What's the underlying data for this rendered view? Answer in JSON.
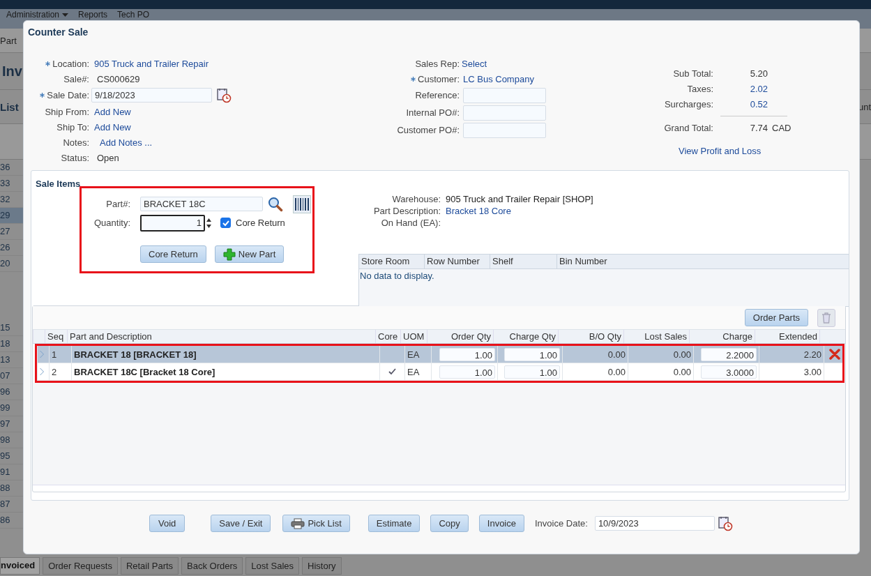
{
  "app_bar": {
    "menu": [
      {
        "label": "Administration",
        "has_dropdown": true
      },
      {
        "label": "Reports",
        "has_dropdown": false
      },
      {
        "label": "Tech PO",
        "has_dropdown": false
      }
    ]
  },
  "background": {
    "breadcrumb": "Part",
    "heading": "Inv",
    "section_title": "List",
    "right_header": "unt",
    "rows_upper": [
      {
        "value": "36",
        "selected": false
      },
      {
        "value": "33",
        "selected": false
      },
      {
        "value": "32",
        "selected": false
      },
      {
        "value": "29",
        "selected": true
      },
      {
        "value": "27",
        "selected": false
      },
      {
        "value": "26",
        "selected": false
      },
      {
        "value": "20",
        "selected": false
      }
    ],
    "rows_lower": [
      {
        "value": "15",
        "selected": false
      },
      {
        "value": "18",
        "selected": false
      },
      {
        "value": "13",
        "selected": false
      },
      {
        "value": "07",
        "selected": false
      },
      {
        "value": "96",
        "selected": false
      },
      {
        "value": "99",
        "selected": false
      },
      {
        "value": "97",
        "selected": false
      },
      {
        "value": "98",
        "selected": false
      },
      {
        "value": "95",
        "selected": false
      },
      {
        "value": "91",
        "selected": false
      },
      {
        "value": "88",
        "selected": false
      },
      {
        "value": "87",
        "selected": false
      },
      {
        "value": "86",
        "selected": false
      }
    ]
  },
  "bottom_tabs": [
    {
      "label": "nvoiced",
      "selected": true
    },
    {
      "label": "Order Requests",
      "selected": false
    },
    {
      "label": "Retail Parts",
      "selected": false
    },
    {
      "label": "Back Orders",
      "selected": false
    },
    {
      "label": "Lost Sales",
      "selected": false
    },
    {
      "label": "History",
      "selected": false
    }
  ],
  "dialog": {
    "title": "Counter Sale",
    "left_fields": [
      {
        "label": "Location:",
        "required": true,
        "kind": "link",
        "value": "905 Truck and Trailer Repair"
      },
      {
        "label": "Sale#:",
        "required": false,
        "kind": "text",
        "value": "CS000629"
      },
      {
        "label": "Sale Date:",
        "required": true,
        "kind": "date",
        "value": "9/18/2023"
      },
      {
        "label": "Ship From:",
        "required": false,
        "kind": "link",
        "value": "Add New"
      },
      {
        "label": "Ship To:",
        "required": false,
        "kind": "link",
        "value": "Add New"
      },
      {
        "label": "Notes:",
        "required": false,
        "kind": "link",
        "value": "Add Notes ..."
      },
      {
        "label": "Status:",
        "required": false,
        "kind": "text",
        "value": "Open"
      }
    ],
    "middle_fields": [
      {
        "label": "Sales Rep:",
        "required": false,
        "kind": "link",
        "value": "Select"
      },
      {
        "label": "Customer:",
        "required": true,
        "kind": "link",
        "value": "LC Bus Company"
      },
      {
        "label": "Reference:",
        "required": false,
        "kind": "input"
      },
      {
        "label": "Internal PO#:",
        "required": false,
        "kind": "input"
      },
      {
        "label": "Customer PO#:",
        "required": false,
        "kind": "input"
      }
    ],
    "totals": [
      {
        "label": "Sub Total:",
        "kind": "text",
        "value": "5.20"
      },
      {
        "label": "Taxes:",
        "kind": "link",
        "value": "2.02"
      },
      {
        "label": "Surcharges:",
        "kind": "link",
        "value": "0.52"
      },
      {
        "label": "Grand Total:",
        "kind": "total",
        "value": "7.74",
        "currency": "CAD"
      }
    ],
    "profit_link": "View Profit and Loss",
    "sale_items": {
      "title": "Sale Items",
      "part_label": "Part#:",
      "part_value": "BRACKET 18C",
      "quantity_label": "Quantity:",
      "quantity_value": "1",
      "core_return": {
        "label": "Core Return",
        "checked": true
      },
      "buttons": [
        {
          "label": "Core Return",
          "kind": "plain"
        },
        {
          "label": "New Part",
          "kind": "add"
        }
      ],
      "info": [
        {
          "label": "Warehouse:",
          "kind": "text",
          "value": "905 Truck and Trailer Repair [SHOP]"
        },
        {
          "label": "Part Description:",
          "kind": "link",
          "value": "Bracket 18 Core"
        },
        {
          "label": "On Hand (EA):",
          "kind": "text"
        }
      ],
      "location_grid": {
        "columns": [
          "Store Room",
          "Row Number",
          "Shelf",
          "Bin Number"
        ],
        "empty_text": "No data to display."
      }
    },
    "items_grid": {
      "order_button": "Order Parts",
      "columns": [
        "Seq",
        "Part and Description",
        "Core",
        "UOM",
        "Order Qty",
        "Charge Qty",
        "B/O Qty",
        "Lost Sales",
        "Charge",
        "Extended"
      ],
      "rows": [
        {
          "seq": "1",
          "part": "BRACKET 18 [BRACKET 18]",
          "core": false,
          "uom": "EA",
          "order_qty": "1.00",
          "charge_qty": "1.00",
          "bo_qty": "0.00",
          "lost_sales": "0.00",
          "charge": "2.2000",
          "extended": "2.20",
          "selected": true
        },
        {
          "seq": "2",
          "part": "BRACKET 18C [Bracket 18 Core]",
          "core": true,
          "uom": "EA",
          "order_qty": "1.00",
          "charge_qty": "1.00",
          "bo_qty": "0.00",
          "lost_sales": "0.00",
          "charge": "3.0000",
          "extended": "3.00",
          "selected": false
        }
      ]
    },
    "footer": {
      "buttons": [
        {
          "label": "Void",
          "kind": "plain"
        },
        {
          "label": "Save / Exit",
          "kind": "plain"
        },
        {
          "label": "Pick List",
          "kind": "print"
        },
        {
          "label": "Estimate",
          "kind": "plain"
        },
        {
          "label": "Copy",
          "kind": "plain"
        },
        {
          "label": "Invoice",
          "kind": "plain"
        }
      ],
      "invoice_date_label": "Invoice Date:",
      "invoice_date": "10/9/2023"
    }
  }
}
